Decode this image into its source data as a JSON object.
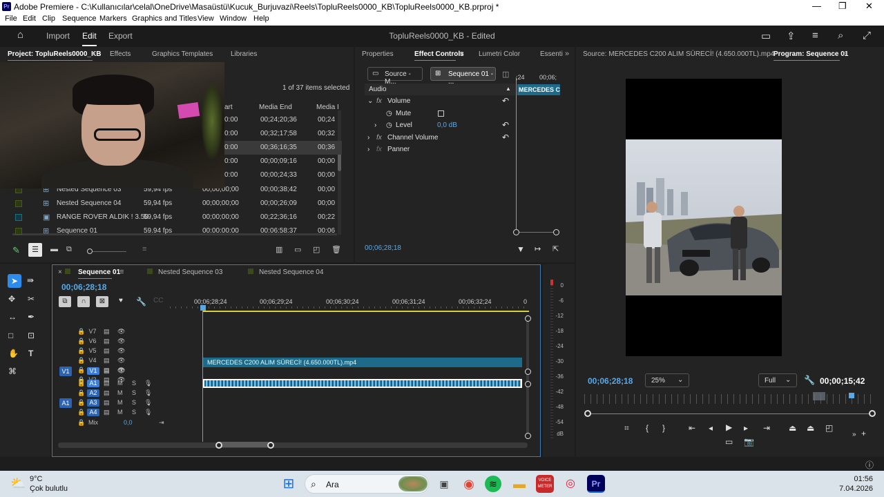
{
  "window": {
    "title": "Adobe Premiere - C:\\Kullanıcılar\\celal\\OneDrive\\Masaüstü\\Kucuk_Burjuvazi\\Reels\\TopluReels0000_KB\\TopluReels0000_KB.prproj *",
    "logo": "Pr"
  },
  "menu": [
    "File",
    "Edit",
    "Clip",
    "Sequence",
    "Markers",
    "Graphics and Titles",
    "View",
    "Window",
    "Help"
  ],
  "header": {
    "workspaces": [
      "Import",
      "Edit",
      "Export"
    ],
    "document": "TopluReels0000_KB - Edited"
  },
  "project_panel": {
    "tabs": [
      "Project: TopluReels0000_KB",
      "Effects",
      "Graphics Templates",
      "Libraries"
    ],
    "selection_info": "1 of 37 items selected",
    "columns": [
      "art",
      "Media End",
      "Media I"
    ],
    "rows": [
      {
        "name": "",
        "fps": "",
        "start": "0:00",
        "end": "00;24;20;36",
        "dur": "00;24"
      },
      {
        "name": "",
        "fps": "",
        "start": "0:00",
        "end": "00;32;17;58",
        "dur": "00;32"
      },
      {
        "name": "",
        "fps": "",
        "start": "0:00",
        "end": "00;36;16;35",
        "dur": "00;36"
      },
      {
        "name": "",
        "fps": "",
        "start": "0:00",
        "end": "00;00;09;16",
        "dur": "00;00"
      },
      {
        "name": "",
        "fps": "",
        "start": "0:00",
        "end": "00;00;24;33",
        "dur": "00;00"
      },
      {
        "name": "Nested Sequence 03",
        "fps": "59,94 fps",
        "start": "00;00;00;00",
        "end": "00;00;38;42",
        "dur": "00;00"
      },
      {
        "name": "Nested Sequence 04",
        "fps": "59,94 fps",
        "start": "00;00;00;00",
        "end": "00;00;26;09",
        "dur": "00;00"
      },
      {
        "name": "RANGE ROVER ALDIK ! 3.50",
        "fps": "59,94 fps",
        "start": "00;00;00;00",
        "end": "00;22;36;16",
        "dur": "00;22"
      },
      {
        "name": "Sequence 01",
        "fps": "59.94 fps",
        "start": "00:00:00:00",
        "end": "00:06:58:37",
        "dur": "00:06"
      }
    ]
  },
  "effect_panel": {
    "tabs": [
      "Properties",
      "Effect Controls",
      "Lumetri Color",
      "Essenti"
    ],
    "source_btn": "Source - M...",
    "seq_btn": "Sequence 01 - ...",
    "mini_ruler": [
      ";24",
      "00;06;"
    ],
    "clip_label": "MERCEDES C2",
    "section": "Audio",
    "rows": [
      {
        "label": "Volume",
        "kind": "fx"
      },
      {
        "label": "Mute",
        "kind": "param"
      },
      {
        "label": "Level",
        "kind": "param",
        "value": "0,0 dB"
      },
      {
        "label": "Channel Volume",
        "kind": "fx"
      },
      {
        "label": "Panner",
        "kind": "fx"
      }
    ],
    "timecode": "00;06;28;18"
  },
  "source_panel": {
    "title": "Source: MERCEDES C200 ALIM SÜRECİ! (4.650.000TL).mp4"
  },
  "program_panel": {
    "title": "Program: Sequence 01",
    "timecode": "00;06;28;18",
    "zoom": "25%",
    "quality": "Full",
    "duration": "00;00;15;42"
  },
  "timeline": {
    "tabs": [
      "Sequence 01",
      "Nested Sequence 03",
      "Nested Sequence 04"
    ],
    "timecode": "00;06;28;18",
    "ruler": [
      "00;06;28;24",
      "00;06;29;24",
      "00;06;30;24",
      "00;06;31;24",
      "00;06;32;24",
      "0"
    ],
    "video_tracks": [
      "V7",
      "V6",
      "V5",
      "V4",
      "V3",
      "V2",
      "V1"
    ],
    "audio_tracks": [
      "A1",
      "A2",
      "A3",
      "A4"
    ],
    "mix_label": "Mix",
    "mix_value": "0,0",
    "clip_name": "MERCEDES C200 ALIM SÜRECİ! (4.650.000TL).mp4",
    "source_patch_v": "V1",
    "source_patch_a": "A1",
    "meter_scale": [
      "0",
      "-6",
      "-12",
      "-18",
      "-24",
      "-30",
      "-36",
      "-42",
      "-48",
      "-54",
      "dB"
    ]
  },
  "taskbar": {
    "temp": "9°C",
    "weather": "Çok bulutlu",
    "search": "Ara",
    "time": "01:56",
    "date": "7.04.2026",
    "voice_label": "VOICE METER",
    "pr_label": "Pr"
  },
  "colors": {
    "accent": "#2d8ceb",
    "clip": "#1e6a8a",
    "audio": "#67c7f0",
    "playhead": "#5aa9e6"
  }
}
